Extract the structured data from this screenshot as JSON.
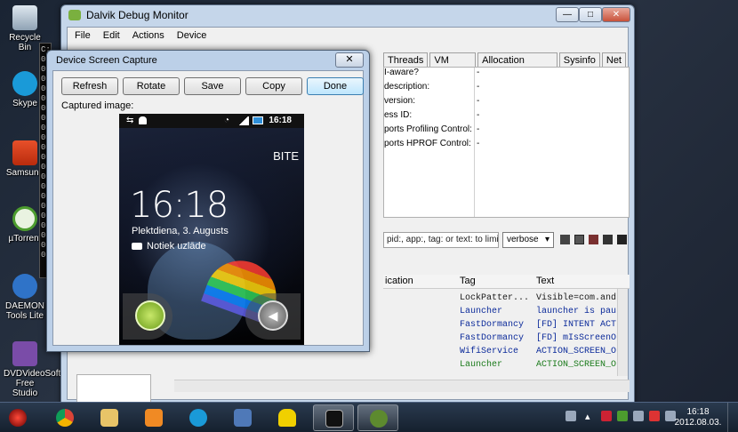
{
  "desktop": {
    "icons": [
      {
        "label": "Recycle Bin"
      },
      {
        "label": "Skype"
      },
      {
        "label": "Samsung"
      },
      {
        "label": "µTorrent"
      },
      {
        "label": "DAEMON Tools Lite"
      },
      {
        "label": "DVDVideoSoft Free Studio"
      }
    ],
    "console_lines": [
      "C:\\",
      "0",
      "0",
      "0",
      "0",
      "0",
      "0",
      "0",
      "0",
      "0",
      "0",
      "0",
      "0",
      "0",
      "0",
      "0",
      "0",
      "0",
      "0",
      "0",
      "0",
      "0"
    ]
  },
  "ddms": {
    "title": "Dalvik Debug Monitor",
    "menu": [
      "File",
      "Edit",
      "Actions",
      "Device"
    ],
    "tabs": [
      "Threads",
      "VM Heap",
      "Allocation Tracker",
      "Sysinfo",
      "Net"
    ],
    "info_rows": [
      {
        "key": "I-aware?",
        "value": "-"
      },
      {
        "key": "description:",
        "value": "-"
      },
      {
        "key": "version:",
        "value": "-"
      },
      {
        "key": "ess ID:",
        "value": "-"
      },
      {
        "key": "ports Profiling Control:",
        "value": "-"
      },
      {
        "key": "ports HPROF Control:",
        "value": "-"
      }
    ],
    "logcat": {
      "filter_placeholder": "pid:, app:, tag: or text: to limit",
      "level": "verbose",
      "columns": [
        "ication",
        "Tag",
        "Text"
      ],
      "rows": [
        {
          "tag": "LockPatter...",
          "text": "Visible=com.and",
          "color": "#1a1a1a"
        },
        {
          "tag": "Launcher",
          "text": "launcher is pau",
          "color": "#0b2a9a"
        },
        {
          "tag": "FastDormancy",
          "text": "[FD] INTENT ACT",
          "color": "#0b2a9a"
        },
        {
          "tag": "FastDormancy",
          "text": "[FD] mIsScreenO",
          "color": "#0b2a9a"
        },
        {
          "tag": "WifiService",
          "text": "ACTION_SCREEN_O",
          "color": "#0b2a9a"
        },
        {
          "tag": "Launcher",
          "text": "ACTION_SCREEN_O",
          "color": "#1a7a1a"
        }
      ]
    }
  },
  "capture_dialog": {
    "title": "Device Screen Capture",
    "buttons": {
      "refresh": "Refresh",
      "rotate": "Rotate",
      "save": "Save",
      "copy": "Copy",
      "done": "Done"
    },
    "captured_label": "Captured image:",
    "phone": {
      "status_time": "16:18",
      "carrier": "BITE",
      "clock": "16:18",
      "date": "Plektdiena, 3. Augusts",
      "charging": "Notiek uzlāde"
    }
  },
  "taskbar": {
    "time": "16:18",
    "date": "2012.08.03."
  }
}
